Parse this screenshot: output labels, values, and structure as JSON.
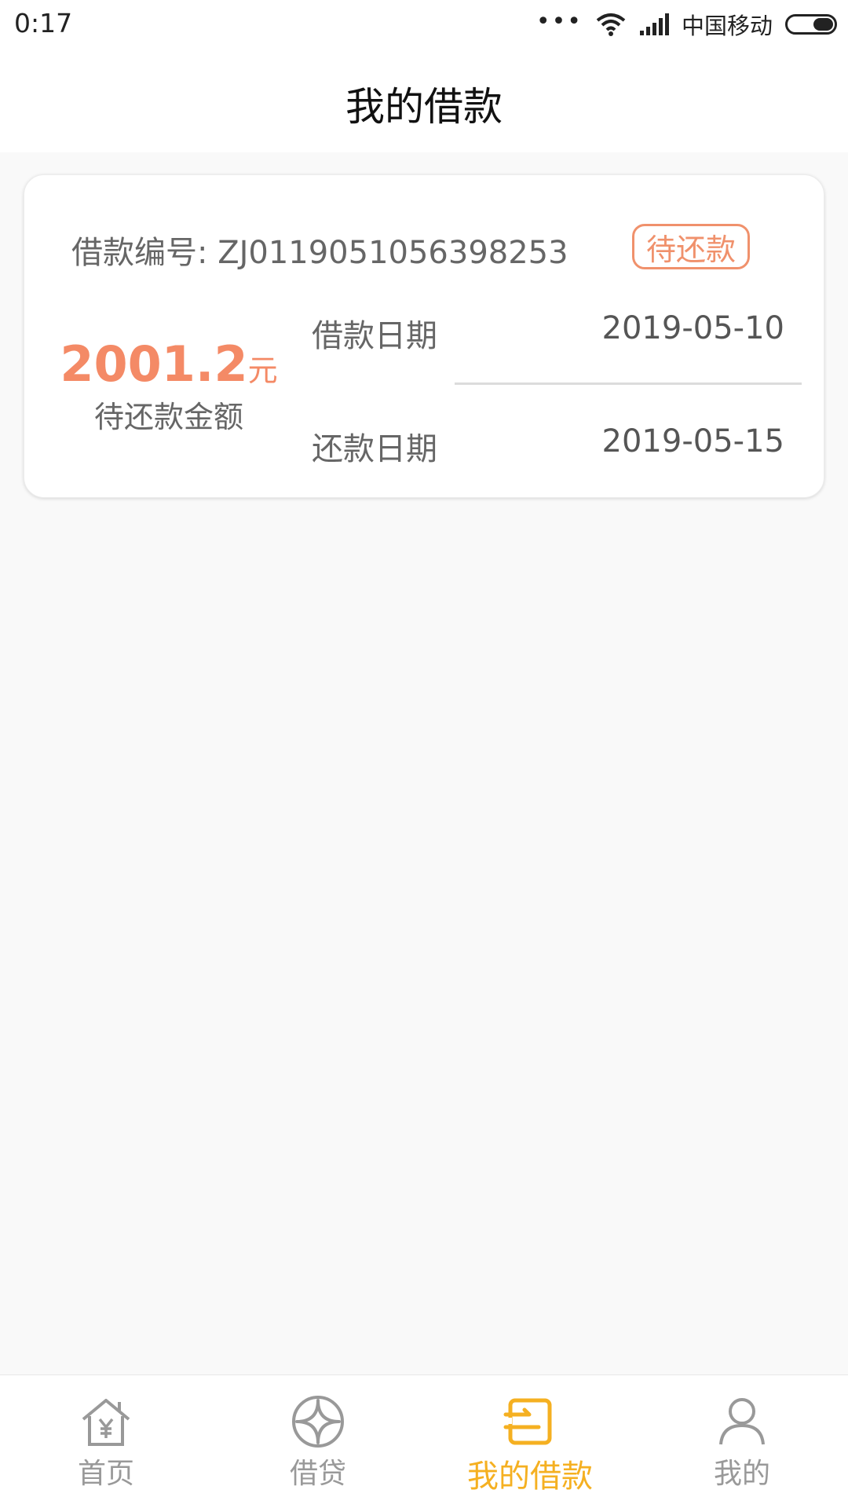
{
  "status_bar": {
    "time": "0:17",
    "dots": "•••",
    "carrier": "中国移动",
    "battery_level": 0.45
  },
  "header": {
    "title": "我的借款"
  },
  "loan": {
    "id_label": "借款编号: ZJ0119051056398253",
    "status": "待还款",
    "amount": "2001.2",
    "amount_unit": "元",
    "amount_label": "待还款金额",
    "borrow_date_label": "借款日期",
    "borrow_date": "2019-05-10",
    "repay_date_label": "还款日期",
    "repay_date": "2019-05-15"
  },
  "nav": {
    "items": [
      {
        "label": "首页",
        "icon": "home-yen-icon",
        "active": false
      },
      {
        "label": "借贷",
        "icon": "loan-circle-icon",
        "active": false
      },
      {
        "label": "我的借款",
        "icon": "my-loan-icon",
        "active": true
      },
      {
        "label": "我的",
        "icon": "user-icon",
        "active": false
      }
    ]
  },
  "colors": {
    "accent": "#f48a66",
    "nav_active": "#f5b021",
    "nav_inactive": "#999999"
  }
}
